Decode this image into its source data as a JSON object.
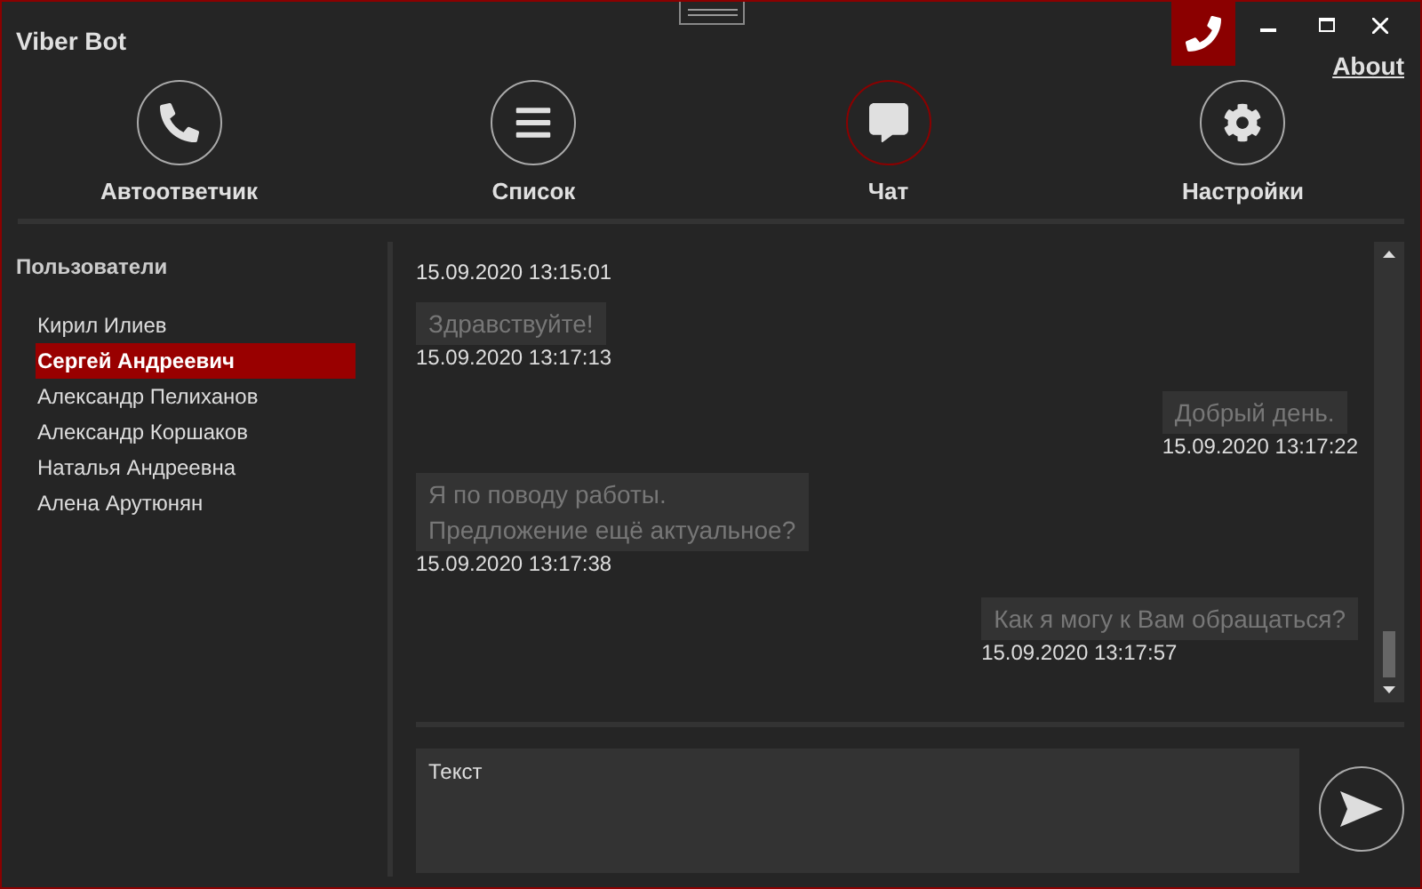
{
  "window": {
    "title": "Viber Bot",
    "about_link": "About"
  },
  "nav": [
    {
      "label": "Автоответчик",
      "selected": false
    },
    {
      "label": "Список",
      "selected": false
    },
    {
      "label": "Чат",
      "selected": true
    },
    {
      "label": "Настройки",
      "selected": false
    }
  ],
  "sidebar": {
    "title": "Пользователи",
    "items": [
      {
        "label": "Кирил Илиев",
        "selected": false
      },
      {
        "label": "Сергей Андреевич",
        "selected": true
      },
      {
        "label": "Александр Пелиханов",
        "selected": false
      },
      {
        "label": "Александр Коршаков",
        "selected": false
      },
      {
        "label": "Наталья Андреевна",
        "selected": false
      },
      {
        "label": "Алена Арутюнян",
        "selected": false
      }
    ]
  },
  "chat": {
    "top_timestamp": "15.09.2020 13:15:01",
    "messages": [
      {
        "text": "Здравствуйте!",
        "time": "15.09.2020 13:17:13",
        "kind": "received"
      },
      {
        "text": "Добрый день.",
        "time": "15.09.2020 13:17:22",
        "kind": "sent"
      },
      {
        "text": "Я по поводу работы.\nПредложение ещё актуальное?",
        "time": "15.09.2020 13:17:38",
        "kind": "received"
      },
      {
        "text": "Как я могу к Вам обращаться?",
        "time": "15.09.2020 13:17:57",
        "kind": "sent"
      }
    ]
  },
  "composer": {
    "value": "Текст"
  }
}
